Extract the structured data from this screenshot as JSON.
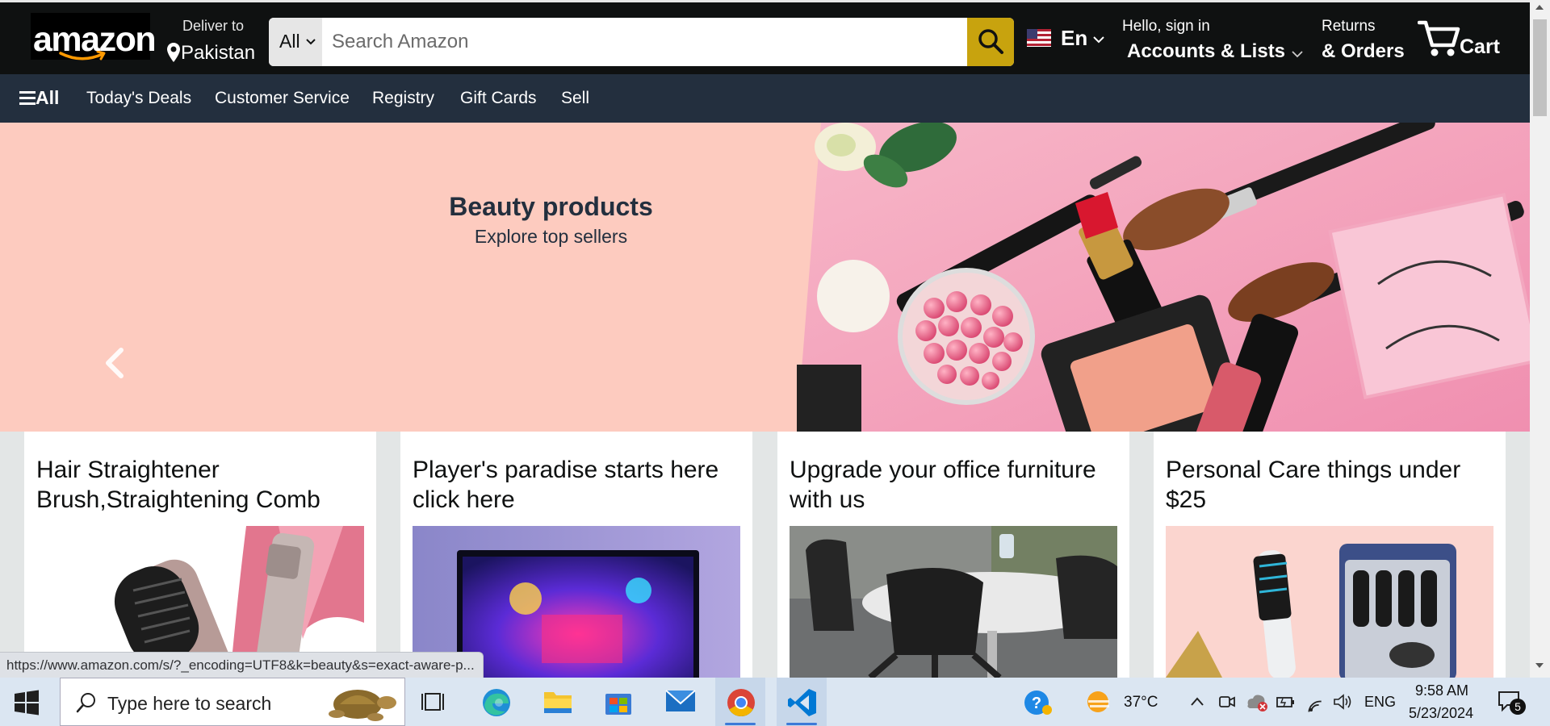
{
  "nav": {
    "logo_text": "amazon",
    "deliver_label": "Deliver to",
    "deliver_location": "Pakistan",
    "search_category": "All",
    "search_placeholder": "Search Amazon",
    "language": "En",
    "greeting": "Hello, sign in",
    "account_label": "Accounts & Lists",
    "returns_label": "Returns",
    "orders_label": "& Orders",
    "cart_label": "Cart"
  },
  "subnav": {
    "all_label": "All",
    "items": [
      "Today's Deals",
      "Customer Service",
      "Registry",
      "Gift Cards",
      "Sell"
    ]
  },
  "hero": {
    "title": "Beauty products",
    "subtitle": "Explore top sellers",
    "background": "#fdcbbf"
  },
  "cards": [
    {
      "title": "Hair Straightener Brush,Straightening Comb"
    },
    {
      "title": "Player's paradise starts here click here"
    },
    {
      "title": "Upgrade your office furniture with us"
    },
    {
      "title": "Personal Care things under $25"
    }
  ],
  "status_url": "https://www.amazon.com/s/?_encoding=UTF8&k=beauty&s=exact-aware-p...",
  "taskbar": {
    "search_placeholder": "Type here to search",
    "weather_temp": "37°C",
    "language": "ENG",
    "time": "9:58 AM",
    "date": "5/23/2024",
    "notification_count": "5",
    "apps": [
      "task-view",
      "edge",
      "file-explorer",
      "microsoft-store",
      "mail",
      "chrome",
      "vscode"
    ]
  },
  "colors": {
    "nav_bg": "#0f1111",
    "subnav_bg": "#232f3e",
    "search_button": "#c8a30e",
    "accent_orange": "#febd69"
  }
}
